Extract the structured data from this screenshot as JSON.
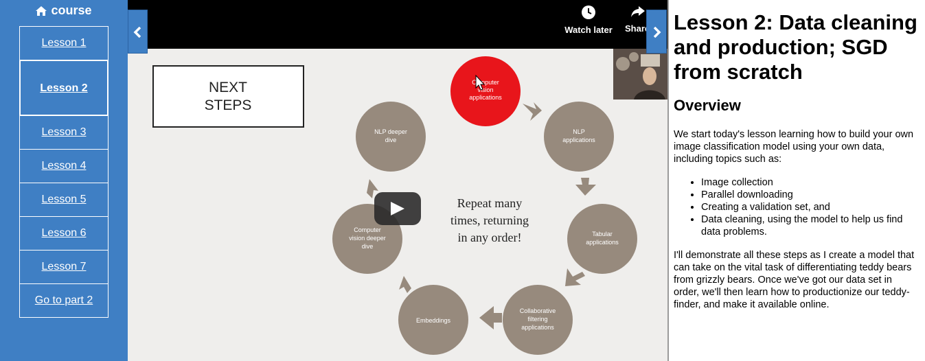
{
  "sidebar": {
    "title": "course",
    "title_icon": "home-icon",
    "lessons": [
      {
        "label": "Lesson 1"
      },
      {
        "label": "Lesson 2"
      },
      {
        "label": "Lesson 3"
      },
      {
        "label": "Lesson 4"
      },
      {
        "label": "Lesson 5"
      },
      {
        "label": "Lesson 6"
      },
      {
        "label": "Lesson 7"
      },
      {
        "label": "Go to part 2"
      }
    ],
    "active_index": 1
  },
  "video": {
    "watch_later_label": "Watch later",
    "share_label": "Share",
    "slide": {
      "box_line1": "NEXT",
      "box_line2": "STEPS",
      "center_line1": "Repeat many",
      "center_line2": "times, returning",
      "center_line3": "in any order!",
      "nodes": [
        {
          "line1": "Computer",
          "line2": "vision",
          "line3": "applications"
        },
        {
          "line1": "NLP",
          "line2": "applications",
          "line3": ""
        },
        {
          "line1": "Tabular",
          "line2": "applications",
          "line3": ""
        },
        {
          "line1": "Collaborative",
          "line2": "filtering",
          "line3": "applications"
        },
        {
          "line1": "Embeddings",
          "line2": "",
          "line3": ""
        },
        {
          "line1": "Computer",
          "line2": "vision deeper",
          "line3": "dive"
        },
        {
          "line1": "NLP deeper",
          "line2": "dive",
          "line3": ""
        }
      ]
    }
  },
  "content": {
    "title": "Lesson 2: Data cleaning and production; SGD from scratch",
    "subtitle": "Overview",
    "intro": "We start today's lesson learning how to build your own image classification model using your own data, including topics such as:",
    "topics": [
      "Image collection",
      "Parallel downloading",
      "Creating a validation set, and",
      "Data cleaning, using the model to help us find data problems."
    ],
    "closing": "I'll demonstrate all these steps as I create a model that can take on the vital task of differentiating teddy bears from grizzly bears. Once we've got our data set in order, we'll then learn how to productionize our teddy-finder, and make it available online."
  },
  "colors": {
    "sidebar": "#3f7fc4",
    "node_grey": "#978a7d",
    "node_active": "#e8151b"
  }
}
